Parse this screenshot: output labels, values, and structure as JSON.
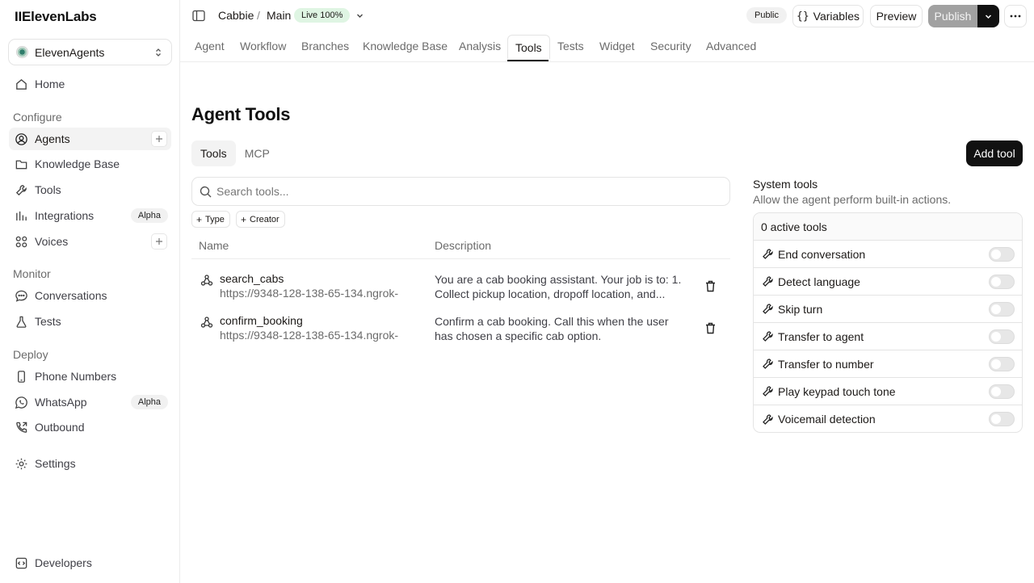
{
  "sidebar": {
    "logo": "IIElevenLabs",
    "workspace": "ElevenAgents",
    "home": "Home",
    "configure_label": "Configure",
    "configure": [
      {
        "label": "Agents"
      },
      {
        "label": "Knowledge Base"
      },
      {
        "label": "Tools"
      },
      {
        "label": "Integrations",
        "badge": "Alpha"
      },
      {
        "label": "Voices"
      }
    ],
    "monitor_label": "Monitor",
    "monitor": [
      {
        "label": "Conversations"
      },
      {
        "label": "Tests"
      }
    ],
    "deploy_label": "Deploy",
    "deploy": [
      {
        "label": "Phone Numbers"
      },
      {
        "label": "WhatsApp",
        "badge": "Alpha"
      },
      {
        "label": "Outbound"
      }
    ],
    "settings": "Settings",
    "developers": "Developers"
  },
  "topbar": {
    "agent": "Cabbie",
    "separator": "/",
    "branch": "Main",
    "live": "Live",
    "live_pct": "100%",
    "visibility": "Public",
    "variables": "Variables",
    "preview": "Preview",
    "publish": "Publish"
  },
  "tabs": [
    "Agent",
    "Workflow",
    "Branches",
    "Knowledge Base",
    "Analysis",
    "Tools",
    "Tests",
    "Widget",
    "Security",
    "Advanced"
  ],
  "main": {
    "title": "Agent Tools",
    "subtabs": [
      "Tools",
      "MCP"
    ],
    "add_tool": "Add tool",
    "search_placeholder": "Search tools...",
    "filters": [
      "Type",
      "Creator"
    ],
    "columns": {
      "name": "Name",
      "description": "Description"
    },
    "tools": [
      {
        "name": "search_cabs",
        "url": "https://9348-128-138-65-134.ngrok-...",
        "description": "You are a cab booking assistant. Your job is to: 1. Collect pickup location, dropoff location, and..."
      },
      {
        "name": "confirm_booking",
        "url": "https://9348-128-138-65-134.ngrok-...",
        "description": "Confirm a cab booking. Call this when the user has chosen a specific cab option."
      }
    ]
  },
  "system_tools": {
    "title": "System tools",
    "subtitle": "Allow the agent perform built-in actions.",
    "active_count": "0 active tools",
    "items": [
      {
        "label": "End conversation",
        "enabled": false
      },
      {
        "label": "Detect language",
        "enabled": false
      },
      {
        "label": "Skip turn",
        "enabled": false
      },
      {
        "label": "Transfer to agent",
        "enabled": false
      },
      {
        "label": "Transfer to number",
        "enabled": false
      },
      {
        "label": "Play keypad touch tone",
        "enabled": false
      },
      {
        "label": "Voicemail detection",
        "enabled": false
      }
    ]
  }
}
